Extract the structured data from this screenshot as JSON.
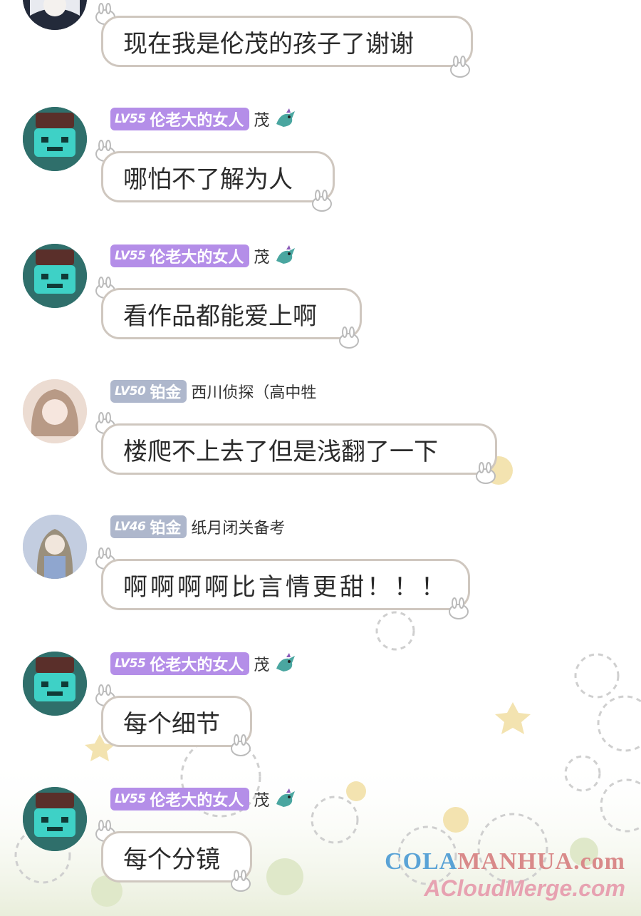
{
  "messages": [
    {
      "avatar": "white-hair-avatar",
      "badge": null,
      "username": "",
      "text": "现在我是伦茂的孩子了谢谢",
      "hand": false,
      "flair": false
    },
    {
      "avatar": "robot-avatar",
      "badge": {
        "level": "LV55",
        "title": "伦老大的女人",
        "color": "#b48ee8"
      },
      "username": "茂",
      "text": "哪怕不了解为人",
      "hand": false,
      "flair": true
    },
    {
      "avatar": "robot-avatar",
      "badge": {
        "level": "LV55",
        "title": "伦老大的女人",
        "color": "#b48ee8"
      },
      "username": "茂",
      "text": "看作品都能爱上啊",
      "hand": false,
      "flair": true
    },
    {
      "avatar": "girl-avatar",
      "badge": {
        "level": "LV50",
        "title": "铂金",
        "color": "#aeb7cc"
      },
      "username": "西川侦探（高中牲",
      "text": "楼爬不上去了但是浅翻了一下",
      "hand": false,
      "flair": false
    },
    {
      "avatar": "braid-girl-avatar",
      "badge": {
        "level": "LV46",
        "title": "铂金",
        "color": "#aeb7cc"
      },
      "username": "纸月闭关备考",
      "text": "啊啊啊啊比言情更甜！！！",
      "hand": true,
      "flair": false
    },
    {
      "avatar": "robot-avatar",
      "badge": {
        "level": "LV55",
        "title": "伦老大的女人",
        "color": "#b48ee8"
      },
      "username": "茂",
      "text": "每个细节",
      "hand": false,
      "flair": true
    },
    {
      "avatar": "robot-avatar",
      "badge": {
        "level": "LV55",
        "title": "伦老大的女人",
        "color": "#b48ee8"
      },
      "username": "茂",
      "text": "每个分镜",
      "hand": false,
      "flair": true
    }
  ],
  "watermark": {
    "line1a": "COLA",
    "line1b": "MANHUA.com",
    "line2": "ACloudMerge.com"
  }
}
